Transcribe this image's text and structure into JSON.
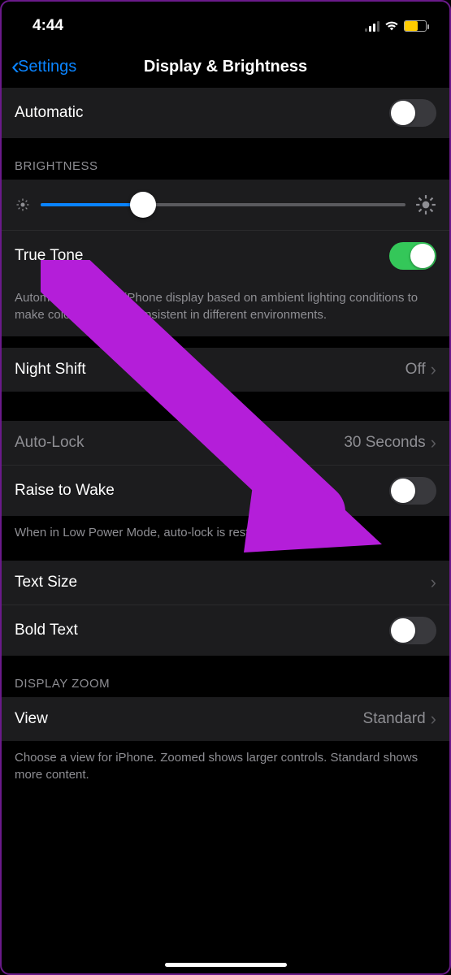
{
  "statusBar": {
    "time": "4:44"
  },
  "nav": {
    "back": "Settings",
    "title": "Display & Brightness"
  },
  "automatic": {
    "label": "Automatic",
    "on": false
  },
  "brightness": {
    "header": "BRIGHTNESS",
    "sliderPercent": 28,
    "trueTone": {
      "label": "True Tone",
      "on": true
    },
    "description": "Automatically adapt iPhone display based on ambient lighting conditions to make colours appear consistent in different environments."
  },
  "nightShift": {
    "label": "Night Shift",
    "value": "Off"
  },
  "autoLock": {
    "label": "Auto-Lock",
    "value": "30 Seconds"
  },
  "raiseToWake": {
    "label": "Raise to Wake",
    "on": false
  },
  "lowPowerNote": "When in Low Power Mode, auto-lock is restricted to 30 seconds.",
  "textSize": {
    "label": "Text Size"
  },
  "boldText": {
    "label": "Bold Text",
    "on": false
  },
  "displayZoom": {
    "header": "DISPLAY ZOOM",
    "view": {
      "label": "View",
      "value": "Standard"
    },
    "footer": "Choose a view for iPhone. Zoomed shows larger controls. Standard shows more content."
  },
  "annotation": {
    "arrowColor": "#b41ed9"
  }
}
